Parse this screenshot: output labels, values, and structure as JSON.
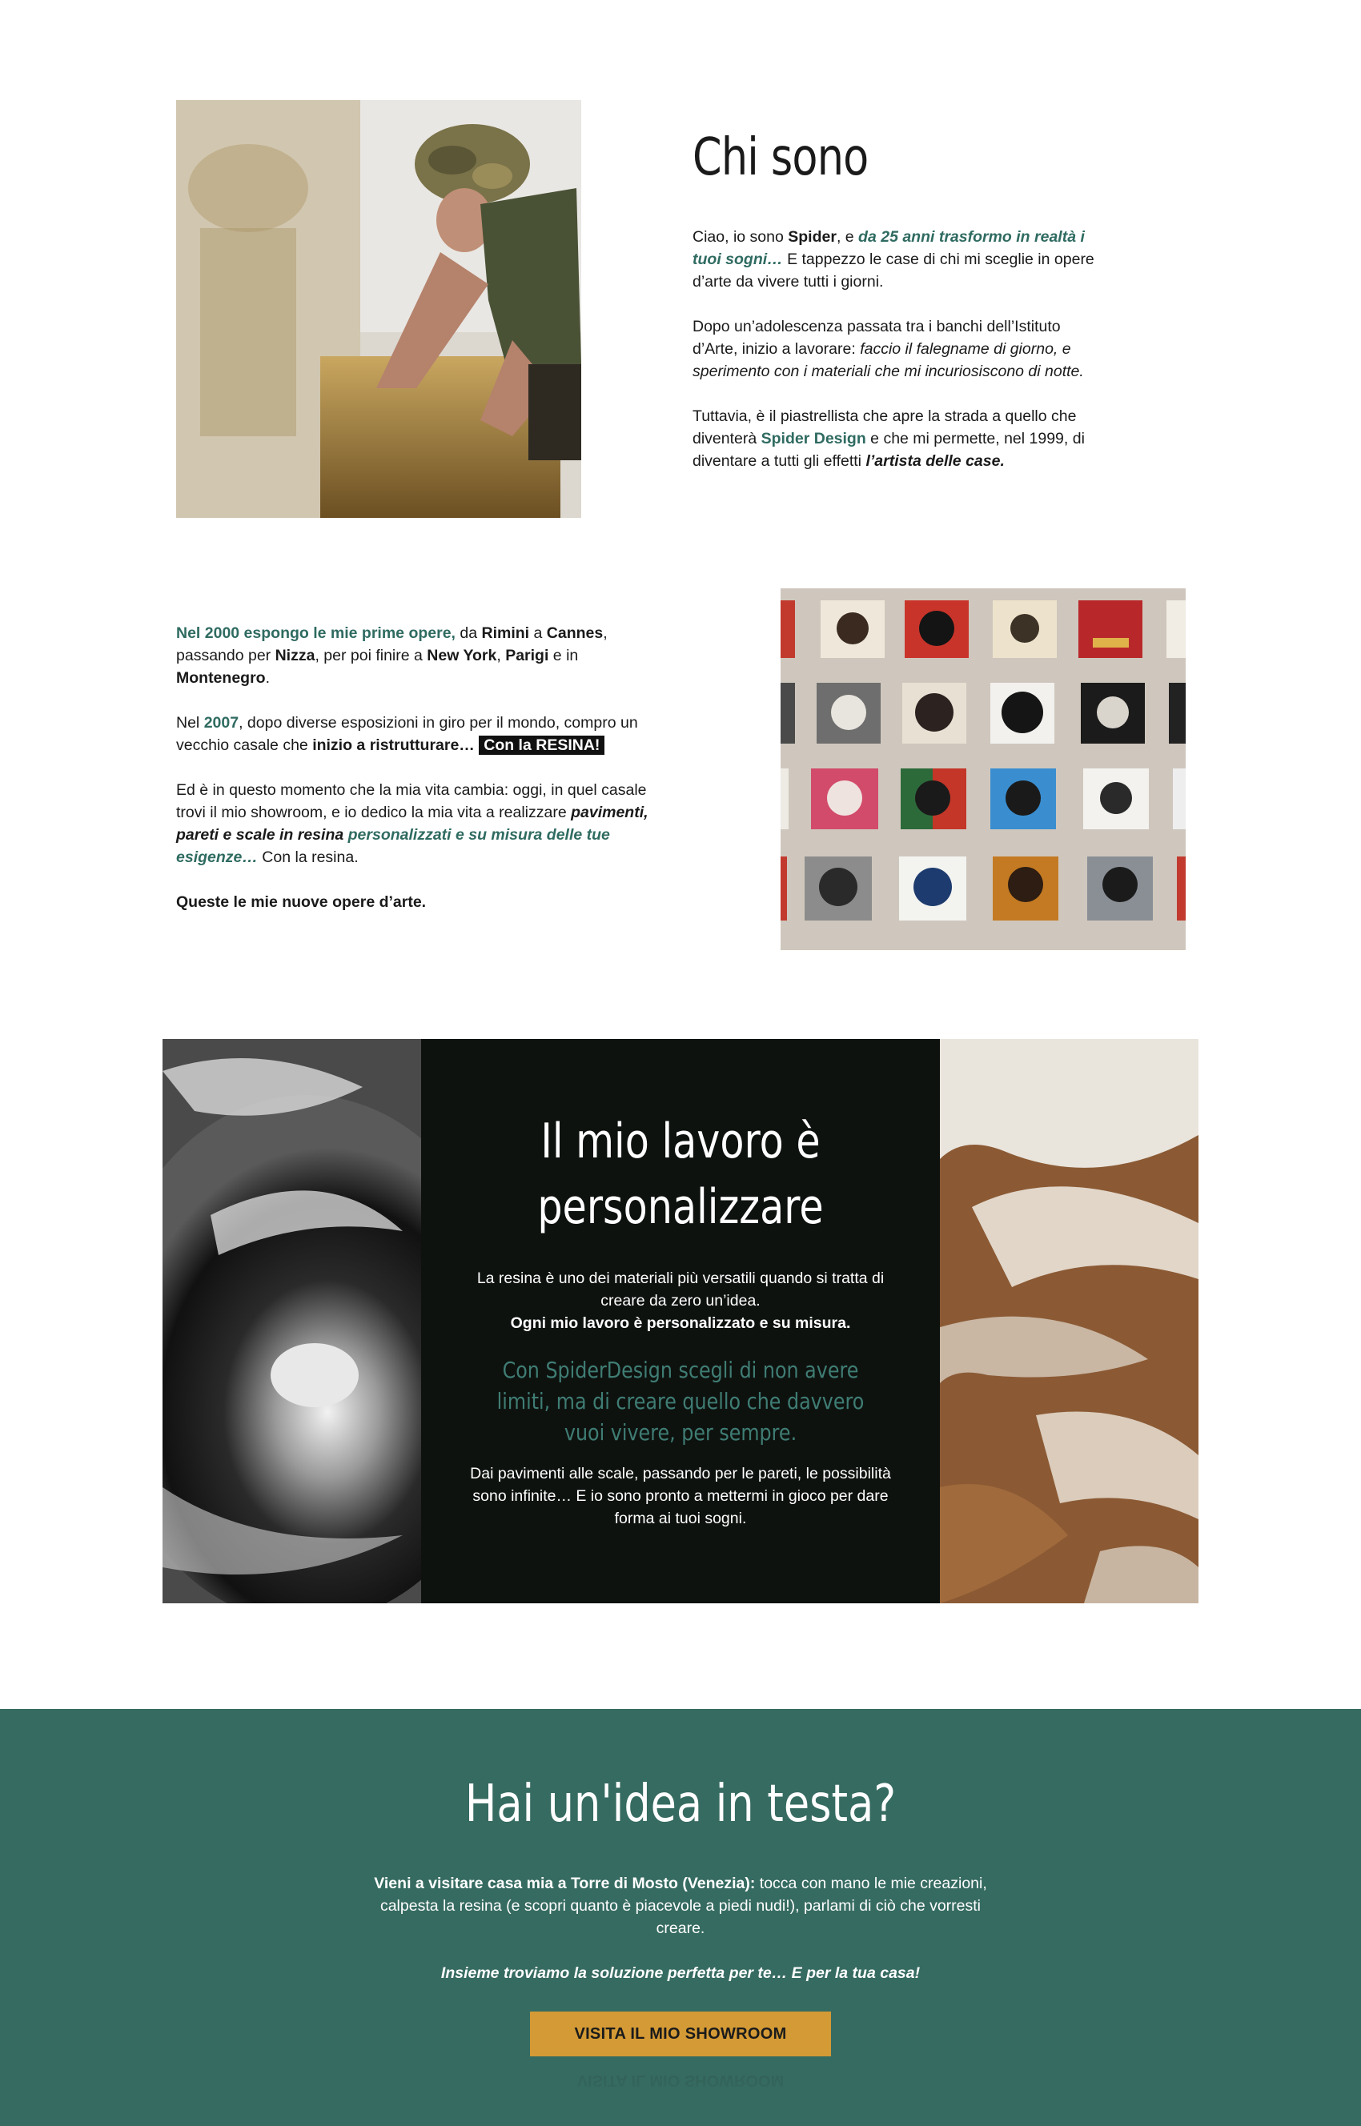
{
  "about": {
    "title": "Chi sono",
    "p1": {
      "a": "Ciao, io sono ",
      "b": "Spider",
      "c": ", e ",
      "d": "da 25 anni trasformo in realtà i tuoi sogni…",
      "e": " E tappezzo le case di chi mi sceglie in opere d’arte da vivere tutti i giorni."
    },
    "p2": {
      "a": "Dopo un’adolescenza passata tra i banchi dell’Istituto d’Arte, inizio a lavorare: ",
      "b": "faccio il falegname di giorno, e sperimento con i materiali che mi incuriosiscono di notte."
    },
    "p3": {
      "a": "Tuttavia, è il piastrellista che apre la strada a quello che diventerà ",
      "b": "Spider Design",
      "c": " e che mi permette, nel 1999, di diventare a tutti gli effetti ",
      "d": "l’artista delle case."
    }
  },
  "story": {
    "p1": {
      "a": "Nel 2000 espongo le mie prime opere,",
      "b": " da ",
      "c": "Rimini",
      "d": " a ",
      "e": "Cannes",
      "f": ", passando per ",
      "g": "Nizza",
      "h": ", per poi finire a ",
      "i": "New York",
      "j": ", ",
      "k": "Parigi",
      "l": " e in ",
      "m": "Montenegro",
      "n": "."
    },
    "p2": {
      "a": "Nel ",
      "b": "2007",
      "c": ", dopo diverse esposizioni in giro per il mondo, compro un vecchio casale che ",
      "d": "inizio a ristrutturare…",
      "e": "Con la RESINA!"
    },
    "p3": {
      "a": "Ed è in questo momento che la mia vita cambia: oggi, in quel casale trovi il mio showroom, e io dedico la mia vita a realizzare ",
      "b": "pavimenti, pareti e scale in resina ",
      "c": "personalizzati e su misura delle tue esigenze…",
      "d": " Con la resina."
    },
    "p4": "Queste le mie nuove opere d’arte."
  },
  "work": {
    "title_line1": "Il mio lavoro è",
    "title_line2": "personalizzare",
    "p1a": "La resina è uno dei materiali più versatili quando si tratta di creare da zero un’idea.",
    "p1b": "Ogni mio lavoro è personalizzato e su misura.",
    "quote": "Con SpiderDesign scegli di non avere limiti, ma di creare quello che davvero vuoi vivere, per sempre.",
    "p2": "Dai pavimenti alle scale, passando per le pareti, le possibilità sono infinite… E io sono pronto a mettermi in gioco per dare forma ai tuoi sogni."
  },
  "cta": {
    "title": "Hai un'idea in testa?",
    "p1a": "Vieni a visitare casa mia a Torre di Mosto (Venezia):",
    "p1b": " tocca con mano le mie creazioni, calpesta la resina (e scopri quanto è piacevole a piedi nudi!), parlami di ciò che vorresti creare.",
    "p2": "Insieme troviamo la soluzione perfetta per te… E per la tua casa!",
    "button": "VISITA IL MIO SHOWROOM"
  },
  "colors": {
    "accent_green": "#2f6b61",
    "band_green": "#366b61",
    "dark_panel": "#0e120f",
    "button_gold": "#d49a35"
  }
}
